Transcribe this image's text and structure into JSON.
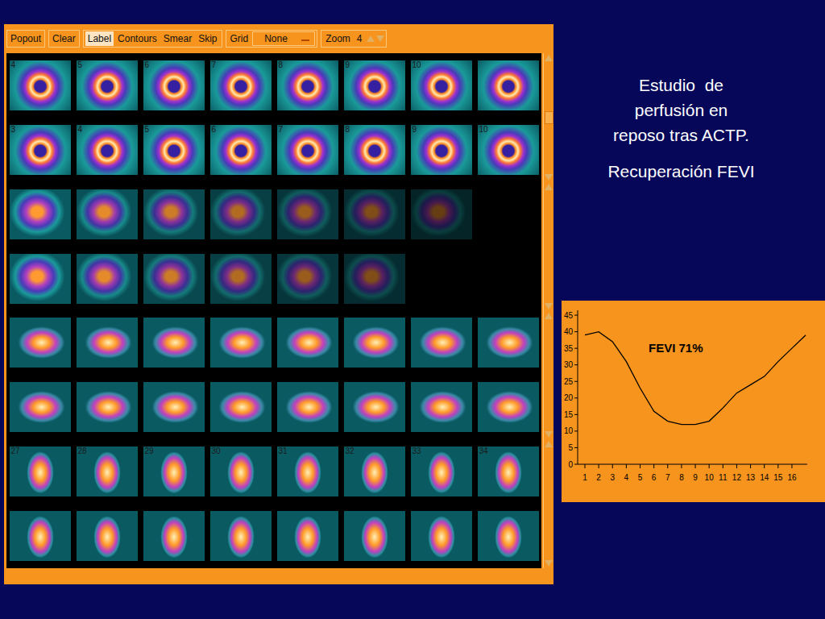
{
  "toolbar": {
    "buttons": [
      {
        "label": "Popout",
        "selected": false
      },
      {
        "label": "Clear",
        "selected": false
      }
    ],
    "modes": [
      {
        "label": "Label",
        "selected": true
      },
      {
        "label": "Contours",
        "selected": false
      },
      {
        "label": "Smear",
        "selected": false
      },
      {
        "label": "Skip",
        "selected": false
      }
    ],
    "grid": {
      "label": "Grid",
      "value": "None"
    },
    "zoom": {
      "label": "Zoom",
      "value": "4"
    }
  },
  "image_rows": [
    {
      "view": "ring",
      "frames": [
        {
          "label": "4"
        },
        {
          "label": "5"
        },
        {
          "label": "6"
        },
        {
          "label": "7"
        },
        {
          "label": "8"
        },
        {
          "label": "9"
        },
        {
          "label": "10"
        },
        {
          "label": ""
        }
      ]
    },
    {
      "view": "ring",
      "frames": [
        {
          "label": "3"
        },
        {
          "label": "4"
        },
        {
          "label": "5"
        },
        {
          "label": "6"
        },
        {
          "label": "7"
        },
        {
          "label": "8"
        },
        {
          "label": "9"
        },
        {
          "label": "10"
        }
      ]
    },
    {
      "view": "fading",
      "frames": [
        {
          "label": ""
        },
        {
          "label": ""
        },
        {
          "label": ""
        },
        {
          "label": ""
        },
        {
          "label": ""
        },
        {
          "label": ""
        },
        {
          "label": ""
        }
      ]
    },
    {
      "view": "fading",
      "frames": [
        {
          "label": ""
        },
        {
          "label": ""
        },
        {
          "label": ""
        },
        {
          "label": ""
        },
        {
          "label": ""
        },
        {
          "label": ""
        }
      ]
    },
    {
      "view": "horseshoe",
      "frames": [
        {
          "label": ""
        },
        {
          "label": ""
        },
        {
          "label": ""
        },
        {
          "label": ""
        },
        {
          "label": ""
        },
        {
          "label": ""
        },
        {
          "label": ""
        },
        {
          "label": ""
        }
      ]
    },
    {
      "view": "horseshoe",
      "frames": [
        {
          "label": ""
        },
        {
          "label": ""
        },
        {
          "label": ""
        },
        {
          "label": ""
        },
        {
          "label": ""
        },
        {
          "label": ""
        },
        {
          "label": ""
        },
        {
          "label": ""
        }
      ]
    },
    {
      "view": "vertical",
      "frames": [
        {
          "label": "27"
        },
        {
          "label": "28"
        },
        {
          "label": "29"
        },
        {
          "label": "30"
        },
        {
          "label": "31"
        },
        {
          "label": "32"
        },
        {
          "label": "33"
        },
        {
          "label": "34"
        }
      ]
    },
    {
      "view": "vertical",
      "frames": [
        {
          "label": ""
        },
        {
          "label": ""
        },
        {
          "label": ""
        },
        {
          "label": ""
        },
        {
          "label": ""
        },
        {
          "label": ""
        },
        {
          "label": ""
        },
        {
          "label": ""
        }
      ]
    }
  ],
  "caption": {
    "lines": [
      "Estudio  de",
      "perfusión en",
      "reposo tras ACTP."
    ],
    "subtitle": "Recuperación FEVI"
  },
  "chart": {
    "title": "FEVI 71%",
    "y_ticks": [
      "0",
      "5",
      "10",
      "15",
      "20",
      "25",
      "30",
      "35",
      "40",
      "45"
    ],
    "x_ticks": [
      "1",
      "2",
      "3",
      "4",
      "5",
      "6",
      "7",
      "8",
      "9",
      "10",
      "11",
      "12",
      "13",
      "14",
      "15",
      "16"
    ],
    "series": [
      {
        "values": [
          39,
          40,
          37,
          31,
          23,
          16,
          13,
          12,
          12,
          13,
          17,
          21.5,
          24,
          26.5,
          31,
          35,
          39
        ]
      }
    ]
  }
}
